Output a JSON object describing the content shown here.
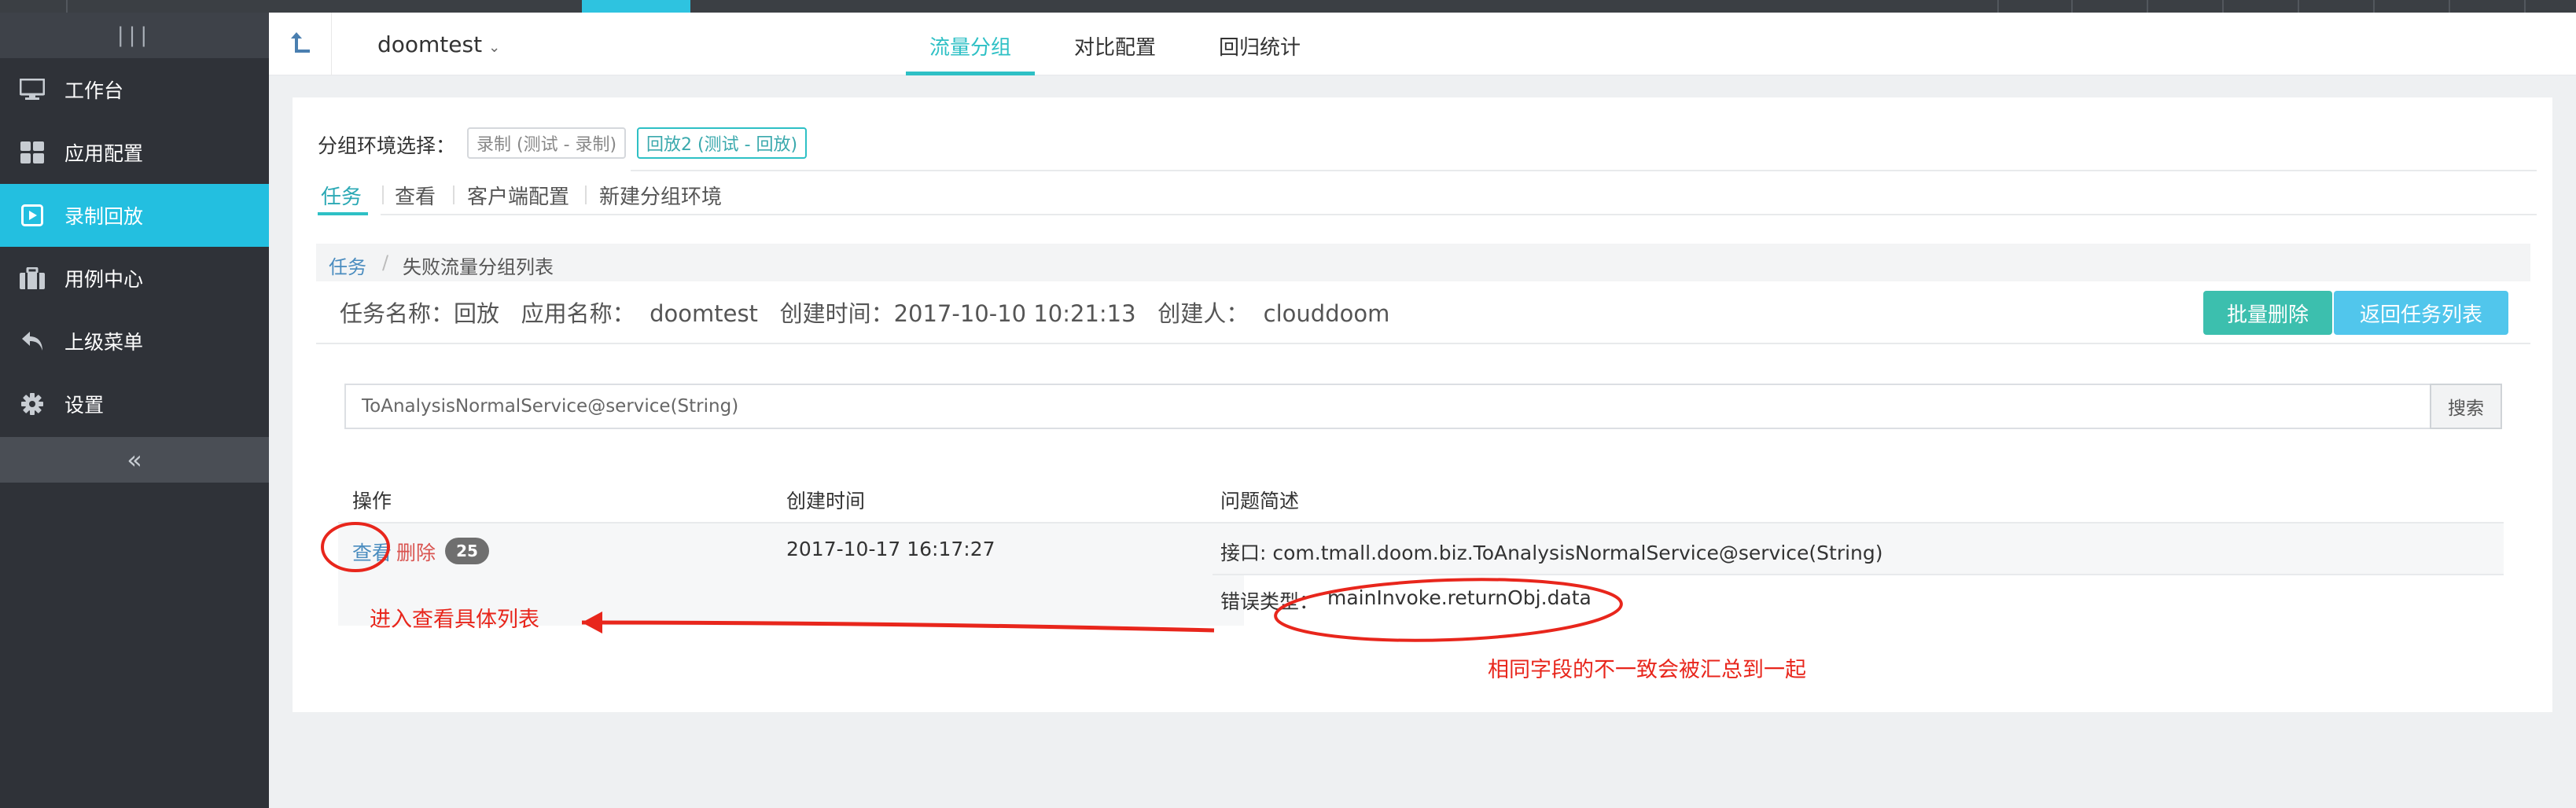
{
  "sidebar": {
    "toggle_icon": "|||",
    "items": [
      {
        "label": "工作台",
        "icon": "monitor-icon"
      },
      {
        "label": "应用配置",
        "icon": "grid-icon"
      },
      {
        "label": "录制回放",
        "icon": "play-icon",
        "active": true
      },
      {
        "label": "用例中心",
        "icon": "briefcase-icon"
      },
      {
        "label": "上级菜单",
        "icon": "undo-icon"
      },
      {
        "label": "设置",
        "icon": "gear-icon"
      }
    ],
    "collapse_icon": "«",
    "bg_color": "#2f3238",
    "active_color": "#23bfe0"
  },
  "header": {
    "app_name": "doomtest",
    "app_chevron": "⌄",
    "tabs": [
      {
        "label": "流量分组",
        "active": true
      },
      {
        "label": "对比配置"
      },
      {
        "label": "回归统计"
      }
    ],
    "accent_color": "#2ec0c5"
  },
  "env": {
    "label": "分组环境选择：",
    "options": [
      {
        "label": "录制 (测试 - 录制)"
      },
      {
        "label": "回放2 (测试 - 回放)",
        "active": true
      }
    ]
  },
  "subtabs": [
    {
      "label": "任务",
      "active": true
    },
    {
      "label": "查看"
    },
    {
      "label": "客户端配置"
    },
    {
      "label": "新建分组环境"
    }
  ],
  "breadcrumb": {
    "root": "任务",
    "separator": "/",
    "current": "失败流量分组列表"
  },
  "task_info": "任务名称：回放   应用名称：  doomtest   创建时间：2017-10-10 10:21:13   创建人：  clouddoom",
  "buttons": {
    "batch_delete": "批量删除",
    "back_to_list": "返回任务列表"
  },
  "search": {
    "value": "ToAnalysisNormalService@service(String)",
    "button": "搜索"
  },
  "table": {
    "headers": [
      "操作",
      "创建时间",
      "问题简述"
    ],
    "rows": [
      {
        "view": "查看",
        "delete": "删除",
        "count": "25",
        "created": "2017-10-17 16:17:27",
        "interface": "接口: com.tmall.doom.biz.ToAnalysisNormalService@service(String)",
        "error_label": "错误类型：",
        "error_value": "mainInvoke.returnObj.data"
      }
    ]
  },
  "annotations": {
    "left": "进入查看具体列表",
    "right": "相同字段的不一致会被汇总到一起",
    "color": "#e8261c"
  }
}
